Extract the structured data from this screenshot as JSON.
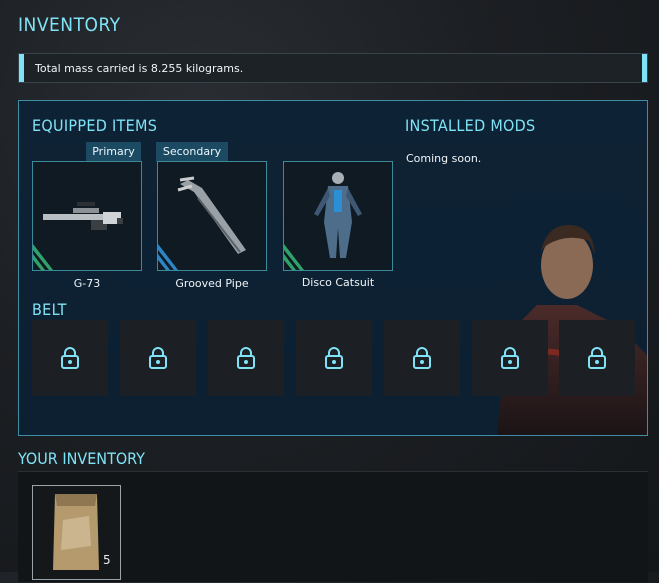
{
  "page": {
    "title": "INVENTORY"
  },
  "mass": {
    "text": "Total mass carried is 8.255 kilograms."
  },
  "equipped": {
    "heading": "EQUIPPED ITEMS",
    "items": [
      {
        "slot": "Primary",
        "name": "G-73",
        "icon": "rifle-icon"
      },
      {
        "slot": "Secondary",
        "name": "Grooved Pipe",
        "icon": "pipe-icon"
      },
      {
        "slot": "",
        "name": "Disco Catsuit",
        "icon": "catsuit-icon"
      }
    ]
  },
  "mods": {
    "heading": "INSTALLED MODS",
    "text": "Coming soon."
  },
  "belt": {
    "heading": "BELT",
    "slot_icon": "lock-icon"
  },
  "your_inventory": {
    "heading": "YOUR INVENTORY",
    "items": [
      {
        "icon": "ration-pack-icon",
        "quantity": "5"
      }
    ]
  },
  "colors": {
    "accent": "#7fe3f5",
    "panel": "#0e2235",
    "border": "#3f8ea6"
  }
}
